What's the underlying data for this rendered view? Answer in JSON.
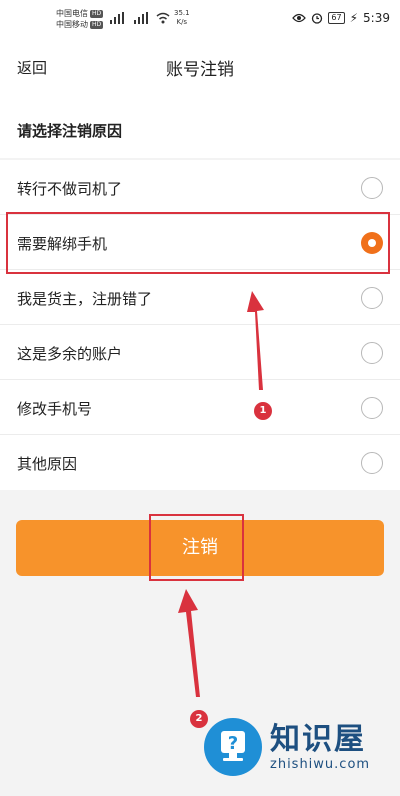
{
  "status_bar": {
    "carrier1": "中国电信",
    "carrier2": "中国移动",
    "hd": "HD",
    "net_speed": "35.1",
    "net_unit": "K/s",
    "battery": "67",
    "time": "5:39"
  },
  "header": {
    "back_label": "返回",
    "title": "账号注销"
  },
  "section_title": "请选择注销原因",
  "reasons": [
    {
      "label": "转行不做司机了",
      "selected": false
    },
    {
      "label": "需要解绑手机",
      "selected": true
    },
    {
      "label": "我是货主，注册错了",
      "selected": false
    },
    {
      "label": "这是多余的账户",
      "selected": false
    },
    {
      "label": "修改手机号",
      "selected": false
    },
    {
      "label": "其他原因",
      "selected": false
    }
  ],
  "submit_button": "注销",
  "annotations": {
    "step1": "1",
    "step2": "2"
  },
  "watermark": {
    "title": "知识屋",
    "subtitle": "zhishiwu.com"
  },
  "colors": {
    "accent": "#f7932b",
    "radio_checked": "#f0701a",
    "annotation_red": "#d9323e"
  }
}
